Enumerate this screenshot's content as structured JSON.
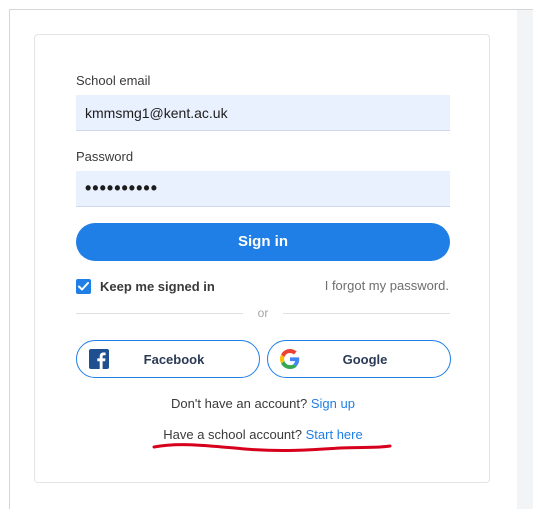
{
  "form": {
    "email_label": "School email",
    "email_value": "kmmsmg1@kent.ac.uk",
    "password_label": "Password",
    "password_value": "kmmsmg1pwd",
    "signin_label": "Sign in",
    "keep_signed_in_label": "Keep me signed in",
    "keep_signed_in_checked": true,
    "forgot_label": "I forgot my password.",
    "divider_text": "or"
  },
  "social": {
    "facebook_label": "Facebook",
    "google_label": "Google"
  },
  "footer": {
    "no_account_text": "Don't have an account?",
    "signup_link": "Sign up",
    "school_account_text": "Have a school account?",
    "start_here_link": "Start here"
  },
  "icons": {
    "facebook": "facebook-logo-icon",
    "google": "google-logo-icon",
    "checkbox": "checkmark-icon"
  },
  "colors": {
    "accent": "#1f7fe6",
    "input_bg": "#e9f0fe",
    "facebook": "#1d4f91",
    "annotation": "#d6001c"
  }
}
